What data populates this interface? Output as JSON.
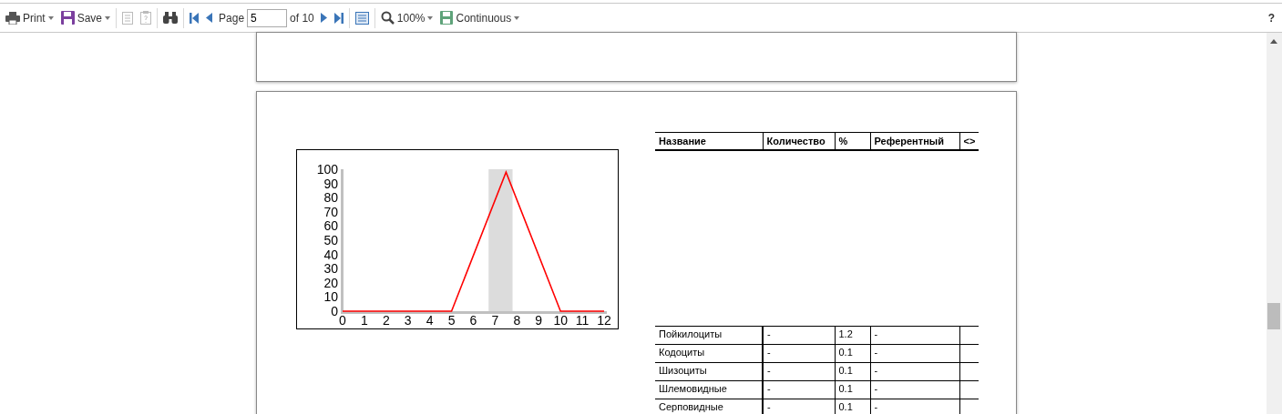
{
  "toolbar": {
    "print": "Print",
    "save": "Save",
    "page_label": "Page",
    "page_value": "5",
    "page_of": "of 10",
    "zoom": "100%",
    "view_mode": "Continuous",
    "help": "?"
  },
  "chart": {
    "chart_data": {
      "type": "line",
      "x": [
        0,
        1,
        2,
        3,
        4,
        5,
        7.5,
        10,
        11,
        12
      ],
      "series": [
        {
          "color": "#ff0000",
          "values": [
            0,
            0,
            0,
            0,
            0,
            0,
            98,
            0,
            0,
            0
          ]
        }
      ],
      "xlim": [
        0,
        12
      ],
      "ylim": [
        0,
        100
      ],
      "xticks": [
        0,
        1,
        2,
        3,
        4,
        5,
        6,
        7,
        8,
        9,
        10,
        11,
        12
      ],
      "yticks": [
        0,
        10,
        20,
        30,
        40,
        50,
        60,
        70,
        80,
        90,
        100
      ],
      "bands": [
        {
          "axis": "x",
          "from": 6.7,
          "to": 7.8
        }
      ]
    }
  },
  "table": {
    "columns": [
      "Название",
      "Количество",
      "%",
      "Референтный",
      "<>"
    ],
    "rows": [
      [
        "Пойкилоциты",
        "-",
        "1.2",
        "-",
        ""
      ],
      [
        "Кодоциты",
        "-",
        "0.1",
        "-",
        ""
      ],
      [
        "Шизоциты",
        "-",
        "0.1",
        "-",
        ""
      ],
      [
        "Шлемовидные",
        "-",
        "0.1",
        "-",
        ""
      ],
      [
        "Серповидные",
        "-",
        "0.1",
        "-",
        ""
      ]
    ]
  }
}
